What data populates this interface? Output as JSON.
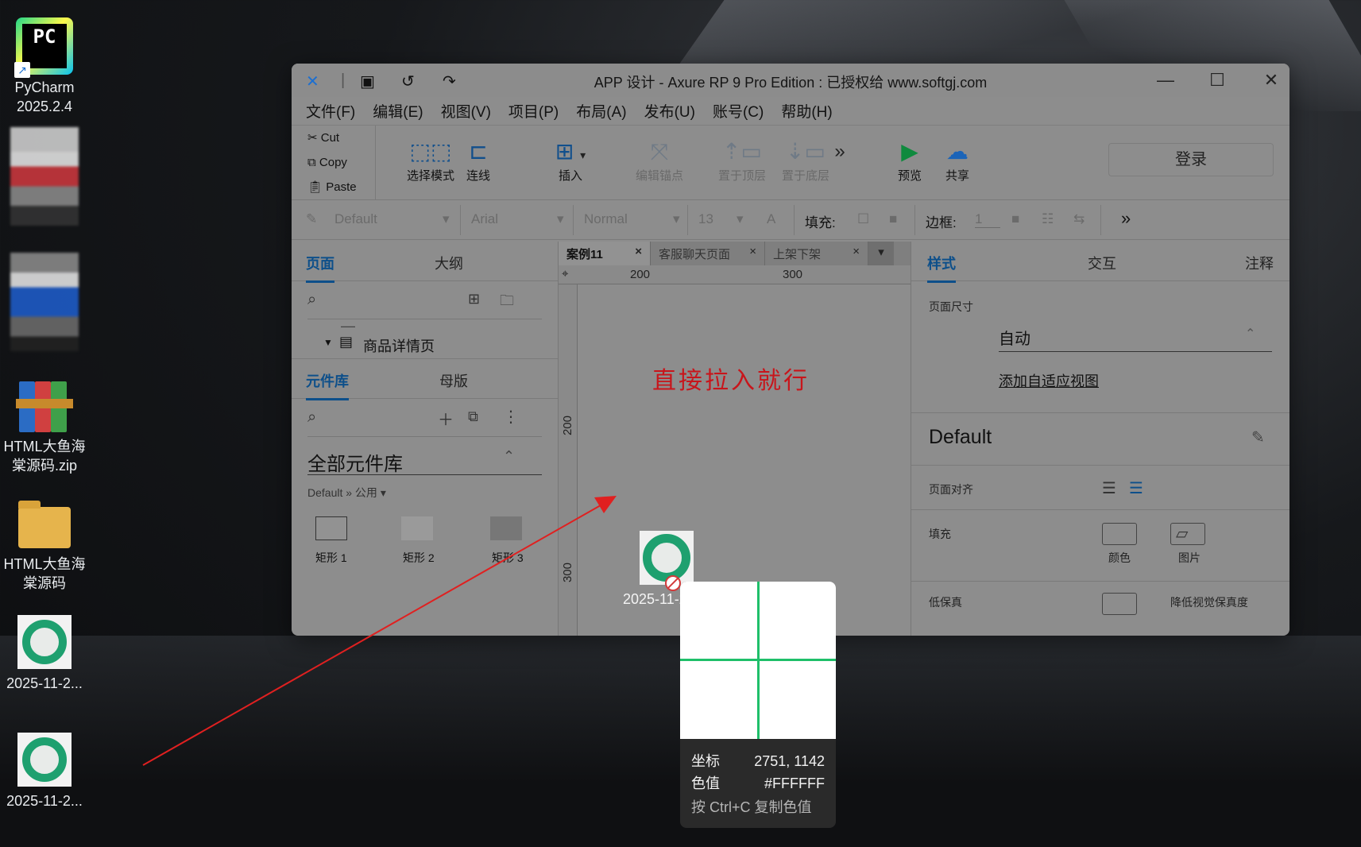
{
  "desktop": {
    "icons": [
      {
        "label": "PyCharm\n2025.2.4"
      },
      {
        "label": "HTML大鱼海\n棠源码.zip"
      },
      {
        "label": "HTML大鱼海\n棠源码"
      },
      {
        "label": "2025-11-2..."
      },
      {
        "label": "2025-11-2..."
      }
    ]
  },
  "window": {
    "title": "APP 设计 - Axure RP 9 Pro Edition : 已授权给 www.softgj.com",
    "menu": [
      "文件(F)",
      "编辑(E)",
      "视图(V)",
      "项目(P)",
      "布局(A)",
      "发布(U)",
      "账号(C)",
      "帮助(H)"
    ],
    "clipboard": [
      "Cut",
      "Copy",
      "Paste"
    ],
    "toolbar": {
      "select_mode": "选择模式",
      "connect": "连线",
      "insert": "插入",
      "edit_anchor": "编辑锚点",
      "bring_front": "置于顶层",
      "send_back": "置于底层",
      "preview": "预览",
      "share": "共享",
      "login": "登录"
    },
    "stylebar": {
      "style": "Default",
      "font": "Arial",
      "weight": "Normal",
      "size": "13",
      "fill_label": "填充:",
      "border_label": "边框:",
      "border_value": "1"
    },
    "left": {
      "tab_pages": "页面",
      "tab_outline": "大纲",
      "page_item": "商品详情页",
      "tab_library": "元件库",
      "tab_masters": "母版",
      "library_select": "全部元件库",
      "library_path": "Default » 公用 ▾",
      "widgets": [
        "矩形 1",
        "矩形 2",
        "矩形 3"
      ]
    },
    "doc_tabs": [
      "案例11",
      "客服聊天页面",
      "上架下架"
    ],
    "ruler": {
      "h": [
        "200",
        "300"
      ],
      "v": [
        "200",
        "300"
      ]
    },
    "canvas_hint": "直接拉入就行",
    "right": {
      "tab_style": "样式",
      "tab_interact": "交互",
      "tab_notes": "注释",
      "page_size_label": "页面尺寸",
      "page_size_value": "自动",
      "adaptive_link": "添加自适应视图",
      "style_name": "Default",
      "page_align_label": "页面对齐",
      "fill_label": "填充",
      "fill_color": "颜色",
      "fill_image": "图片",
      "low_fidelity_label": "低保真",
      "low_fidelity_option": "降低视觉保真度"
    }
  },
  "drag": {
    "label": "2025-11-2..."
  },
  "color_picker": {
    "coord_label": "坐标",
    "coord_value": "2751, 1142",
    "color_label": "色值",
    "color_value": "#FFFFFF",
    "hint": "按 Ctrl+C 复制色值"
  }
}
